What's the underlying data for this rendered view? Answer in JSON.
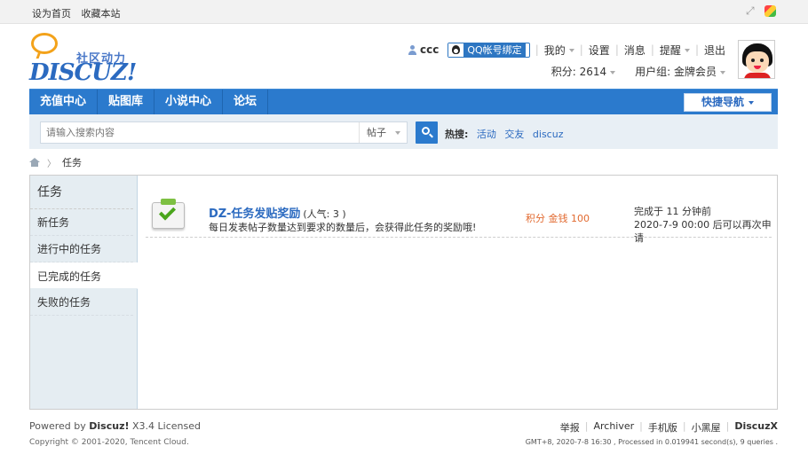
{
  "topbar": {
    "set_home": "设为首页",
    "bookmark": "收藏本站",
    "icons": [
      "expand-icon",
      "color-scheme-icon"
    ]
  },
  "logo": {
    "slogan": "社区动力",
    "wordmark": "DISCUZ!"
  },
  "user": {
    "name": "ccc",
    "qq_bind": "QQ帐号绑定",
    "menu": [
      "我的",
      "设置",
      "消息",
      "提醒",
      "退出"
    ],
    "points_label": "积分: 2614",
    "group_label": "用户组: 金牌会员"
  },
  "nav": {
    "items": [
      "充值中心",
      "贴图库",
      "小说中心",
      "论坛"
    ],
    "quick_nav": "快捷导航",
    "accent": "#2b7acd"
  },
  "search": {
    "placeholder": "请输入搜索内容",
    "type": "帖子",
    "hot_label": "热搜:",
    "hot_terms": [
      "活动",
      "交友",
      "discuz"
    ]
  },
  "breadcrumb": {
    "current": "任务"
  },
  "sidebar": {
    "title": "任务",
    "items": [
      "新任务",
      "进行中的任务",
      "已完成的任务",
      "失败的任务"
    ],
    "active_index": 2
  },
  "task": {
    "name": "DZ-任务发贴奖励",
    "popularity": "(人气: 3 )",
    "description": "每日发表帖子数量达到要求的数量后，会获得此任务的奖励哦!",
    "reward": "积分 金钱 100",
    "completed": "完成于 11 分钟前",
    "reapply": "2020-7-9 00:00 后可以再次申请"
  },
  "footer": {
    "powered_prefix": "Powered by",
    "brand": "Discuz!",
    "version": "X3.4 Licensed",
    "copyright": "Copyright © 2001-2020, Tencent Cloud.",
    "links": [
      "举报",
      "Archiver",
      "手机版",
      "小黑屋"
    ],
    "brand_right": "DiscuzX",
    "stats": "GMT+8, 2020-7-8 16:30 , Processed in 0.019941 second(s), 9 queries ."
  }
}
